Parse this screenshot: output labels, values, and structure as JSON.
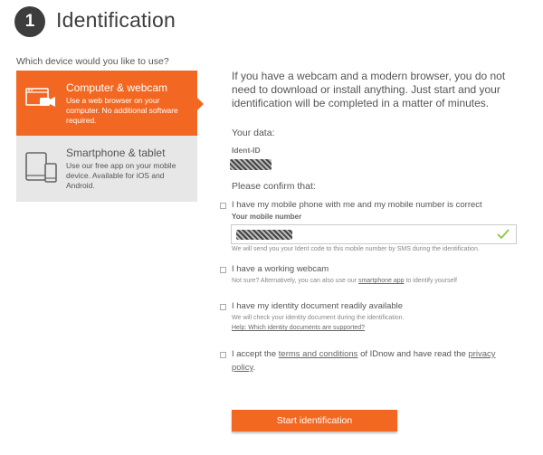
{
  "header": {
    "step_number": "1",
    "title": "Identification"
  },
  "device_question": "Which device would you like to use?",
  "devices": [
    {
      "title": "Computer & webcam",
      "description": "Use a web browser on your computer. No additional software required.",
      "icon": "computer-webcam-icon",
      "selected": true
    },
    {
      "title": "Smartphone & tablet",
      "description": "Use our free app on your mobile device. Available for iOS and Android.",
      "icon": "smartphone-tablet-icon",
      "selected": false
    }
  ],
  "intro": "If you have a webcam and a modern browser, you do not need to download or install anything. Just start and your identification will be completed in a matter of minutes.",
  "data_section": {
    "heading": "Your data:",
    "ident_label": "Ident-ID"
  },
  "confirm_heading": "Please confirm that:",
  "confirmations": {
    "mobile": {
      "label": "I have my mobile phone with me and my mobile number is correct",
      "field_label": "Your mobile number",
      "hint": "We will send you your Ident code to this mobile number by SMS during the identification."
    },
    "webcam": {
      "label": "I have a working webcam",
      "hint_pre": "Not sure? Alternatively, you can also use our ",
      "hint_link": "smartphone app",
      "hint_post": " to identify yourself"
    },
    "document": {
      "label": "I have my identity document readily available",
      "hint": "We will check your identity document during the identification.",
      "help_link": "Help: Which identity documents are supported?"
    },
    "terms": {
      "pre": "I accept the ",
      "terms_link": "terms and conditions",
      "mid": " of IDnow and have read the ",
      "privacy_link_1": "privacy",
      "privacy_link_2": "policy",
      "post": "."
    }
  },
  "start_button": "Start identification",
  "colors": {
    "accent": "#f26822",
    "valid": "#8cc63f",
    "dark": "#3d3d3d"
  }
}
